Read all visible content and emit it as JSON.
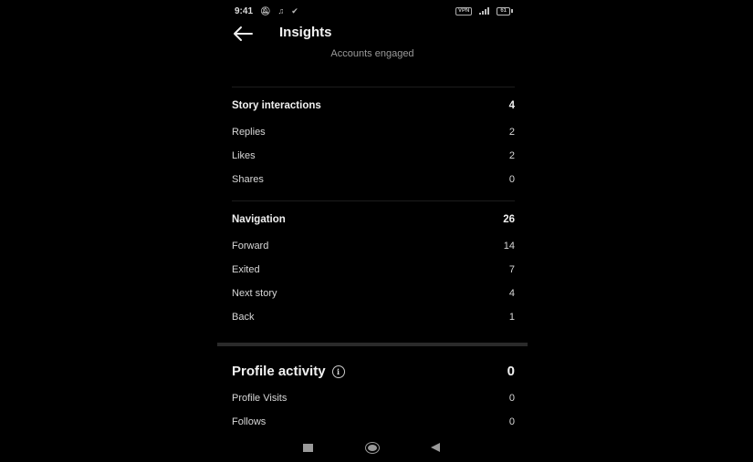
{
  "status_bar": {
    "time": "9:41",
    "icons_left": [
      "notifications-off-icon",
      "music-note-icon",
      "check-icon"
    ],
    "vpn_label": "VPN",
    "battery_level": "61"
  },
  "header": {
    "title": "Insights",
    "back_icon": "arrow-left-icon"
  },
  "subtitle": "Accounts engaged",
  "story_interactions": {
    "label": "Story interactions",
    "total": "4",
    "items": [
      {
        "label": "Replies",
        "value": "2"
      },
      {
        "label": "Likes",
        "value": "2"
      },
      {
        "label": "Shares",
        "value": "0"
      }
    ]
  },
  "navigation": {
    "label": "Navigation",
    "total": "26",
    "items": [
      {
        "label": "Forward",
        "value": "14"
      },
      {
        "label": "Exited",
        "value": "7"
      },
      {
        "label": "Next story",
        "value": "4"
      },
      {
        "label": "Back",
        "value": "1"
      }
    ]
  },
  "profile_activity": {
    "label": "Profile activity",
    "info_icon": "i",
    "total": "0",
    "items": [
      {
        "label": "Profile Visits",
        "value": "0"
      },
      {
        "label": "Follows",
        "value": "0"
      }
    ]
  }
}
